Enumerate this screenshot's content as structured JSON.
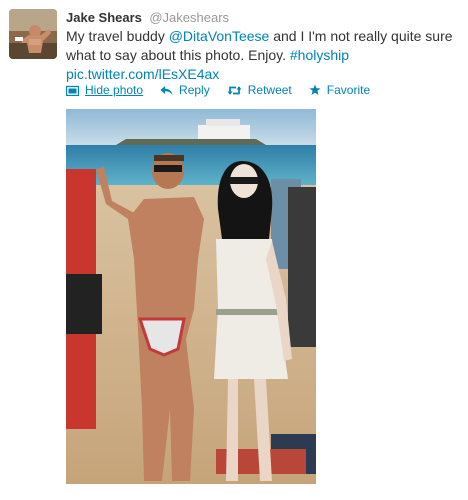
{
  "tweet": {
    "author_name": "Jake Shears",
    "author_handle": "@Jakeshears",
    "text_part1": "My travel buddy ",
    "mention": "@DitaVonTeese",
    "text_part2": " and I I'm not really quite sure what to say about this photo. Enjoy. ",
    "hashtag": "#holyship",
    "link": "pic.twitter.com/lEsXE4ax"
  },
  "actions": {
    "hide_photo": "Hide photo",
    "reply": "Reply",
    "retweet": "Retweet",
    "favorite": "Favorite"
  },
  "icons": {
    "hide_photo": "photo-icon",
    "reply": "reply-arrow-icon",
    "retweet": "retweet-icon",
    "favorite": "star-icon"
  },
  "colors": {
    "link": "#0084b4",
    "name": "#333333",
    "handle": "#999999"
  }
}
